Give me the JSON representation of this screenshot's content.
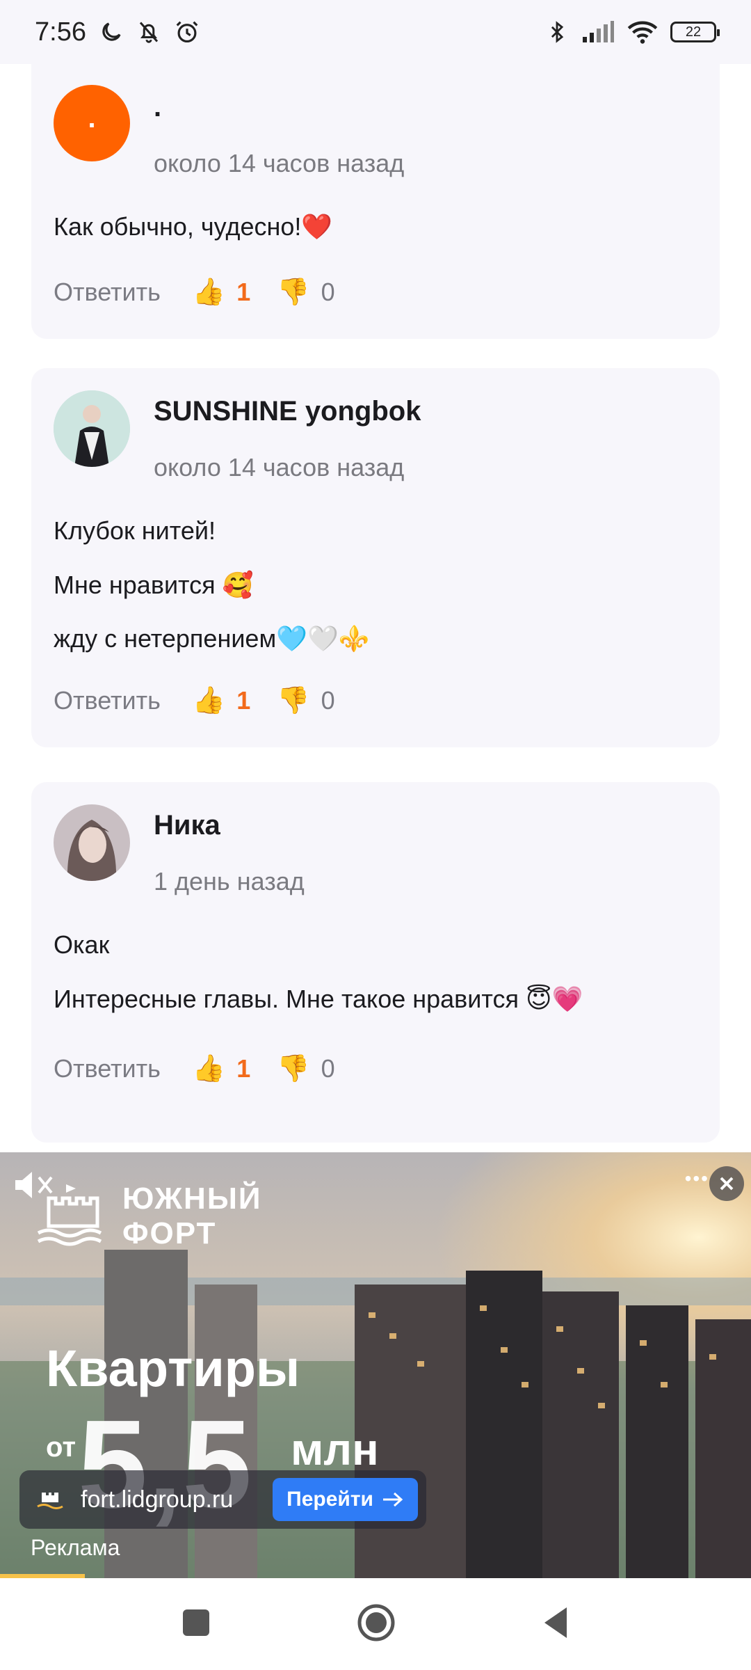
{
  "status_bar": {
    "time": "7:56",
    "battery": "22"
  },
  "comments": [
    {
      "author": ".",
      "avatar_text": ".",
      "time": "около 14 часов назад",
      "lines": [
        "Как обычно, чудесно!❤️"
      ],
      "reply_label": "Ответить",
      "likes": "1",
      "dislikes": "0"
    },
    {
      "author": "SUNSHINE yongbok",
      "time": "около 14 часов назад",
      "lines": [
        "Клубок нитей!",
        "Мне нравится 🥰",
        "жду с нетерпением🩵🤍⚜️"
      ],
      "reply_label": "Ответить",
      "likes": "1",
      "dislikes": "0"
    },
    {
      "author": "Ника",
      "time": "1 день назад",
      "lines": [
        "Окак",
        "Интересные главы. Мне такое нравится 😇💗"
      ],
      "reply_label": "Ответить",
      "likes": "1",
      "dislikes": "0"
    }
  ],
  "icons": {
    "like": "👍",
    "dislike": "👎"
  },
  "ad": {
    "brand_line1": "ЮЖНЫЙ",
    "brand_line2": "ФОРТ",
    "headline": "Квартиры",
    "price_from": "от",
    "price_value": "5,5",
    "price_unit": "млн",
    "domain": "fort.lidgroup.ru",
    "cta": "Перейти",
    "label": "Реклама"
  },
  "colors": {
    "accent_orange": "#f26a1b",
    "card_bg": "#f7f6fb",
    "cta_blue": "#2f7cf6"
  }
}
